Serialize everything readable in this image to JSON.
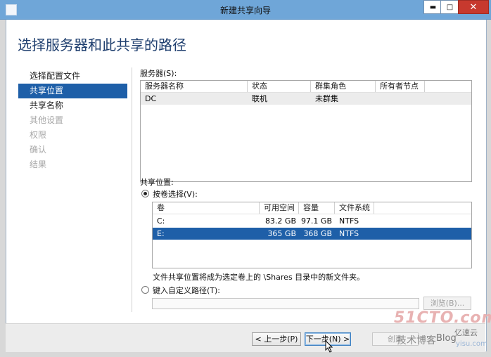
{
  "window": {
    "title": "新建共享向导",
    "minimize": "▬",
    "maximize": "□",
    "close": "✕"
  },
  "heading": "选择服务器和此共享的路径",
  "nav": [
    {
      "label": "选择配置文件",
      "state": "normal"
    },
    {
      "label": "共享位置",
      "state": "active"
    },
    {
      "label": "共享名称",
      "state": "normal"
    },
    {
      "label": "其他设置",
      "state": "disabled"
    },
    {
      "label": "权限",
      "state": "disabled"
    },
    {
      "label": "确认",
      "state": "disabled"
    },
    {
      "label": "结果",
      "state": "disabled"
    }
  ],
  "servers": {
    "label": "服务器(S):",
    "columns": [
      "服务器名称",
      "状态",
      "群集角色",
      "所有者节点"
    ],
    "rows": [
      [
        "DC",
        "联机",
        "未群集",
        ""
      ]
    ]
  },
  "share_location": {
    "label": "共享位置:",
    "by_volume_label": "按卷选择(V):",
    "by_volume_selected": true,
    "volume_columns": [
      "卷",
      "可用空间",
      "容量",
      "文件系统"
    ],
    "volumes": [
      {
        "volume": "C:",
        "free": "83.2 GB",
        "capacity": "97.1 GB",
        "fs": "NTFS",
        "selected": false
      },
      {
        "volume": "E:",
        "free": "365 GB",
        "capacity": "368 GB",
        "fs": "NTFS",
        "selected": true
      }
    ],
    "note": "文件共享位置将成为选定卷上的 \\Shares 目录中的新文件夹。",
    "custom_path_label": "键入自定义路径(T):",
    "custom_path_value": "",
    "browse_label": "浏览(B)..."
  },
  "buttons": {
    "prev": "< 上一步(P)",
    "next": "下一步(N) >",
    "create": "创建"
  },
  "watermark": {
    "site": "51CTO.com",
    "line2": "技术博客",
    "line3": "Blog",
    "line4": "亿速云",
    "line5": "yisu.com"
  }
}
